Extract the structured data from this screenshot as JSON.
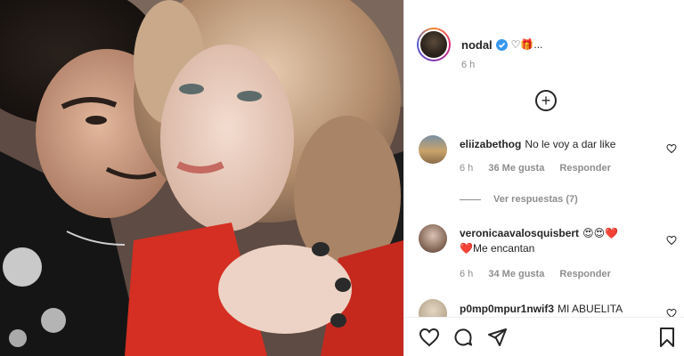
{
  "post": {
    "username": "nodal",
    "caption_emoji": "♡🎁...",
    "time": "6 h"
  },
  "comments": [
    {
      "username": "eliizabethog",
      "text": "No le voy a dar like",
      "time": "6 h",
      "likes": "36 Me gusta",
      "reply": "Responder",
      "view_replies": "Ver respuestas (7)"
    },
    {
      "username": "veronicaavalosquisbert",
      "text_line1": "😍😍❤️",
      "text_line2": "❤️Me encantan",
      "time": "6 h",
      "likes": "34 Me gusta",
      "reply": "Responder"
    },
    {
      "username": "p0mp0mpur1nwif3",
      "text": "MI ABUELITA"
    }
  ],
  "icons": {
    "like": "heart-icon",
    "comment": "comment-icon",
    "share": "send-icon",
    "save": "bookmark-icon",
    "add": "plus-circle-icon",
    "verified": "verified-badge-icon"
  },
  "colors": {
    "verified": "#3897f0",
    "text": "#262626",
    "muted": "#8e8e8e"
  }
}
